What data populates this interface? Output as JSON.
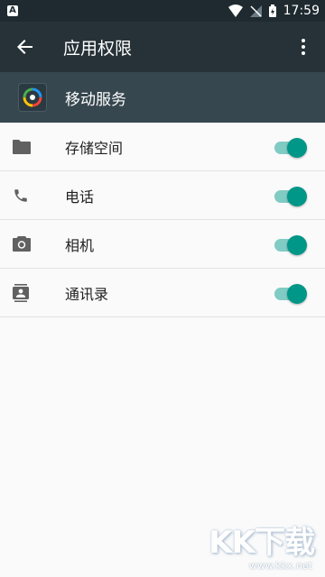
{
  "status_bar": {
    "time": "17:59",
    "notification_icon": "a-icon"
  },
  "toolbar": {
    "title": "应用权限",
    "back_icon": "arrow-left-icon",
    "more_icon": "more-vert-icon"
  },
  "app": {
    "name": "移动服务",
    "icon": "app-logo-icon"
  },
  "permissions": [
    {
      "label": "存储空间",
      "icon": "folder-icon",
      "enabled": true
    },
    {
      "label": "电话",
      "icon": "phone-icon",
      "enabled": true
    },
    {
      "label": "相机",
      "icon": "camera-icon",
      "enabled": true
    },
    {
      "label": "通讯录",
      "icon": "contacts-icon",
      "enabled": true
    }
  ],
  "colors": {
    "toolbar": "#263238",
    "app_header": "#37474f",
    "accent": "#009688",
    "track": "#80cbc4"
  },
  "watermark": {
    "main": "KK下载",
    "url": "www.kkx.net"
  }
}
